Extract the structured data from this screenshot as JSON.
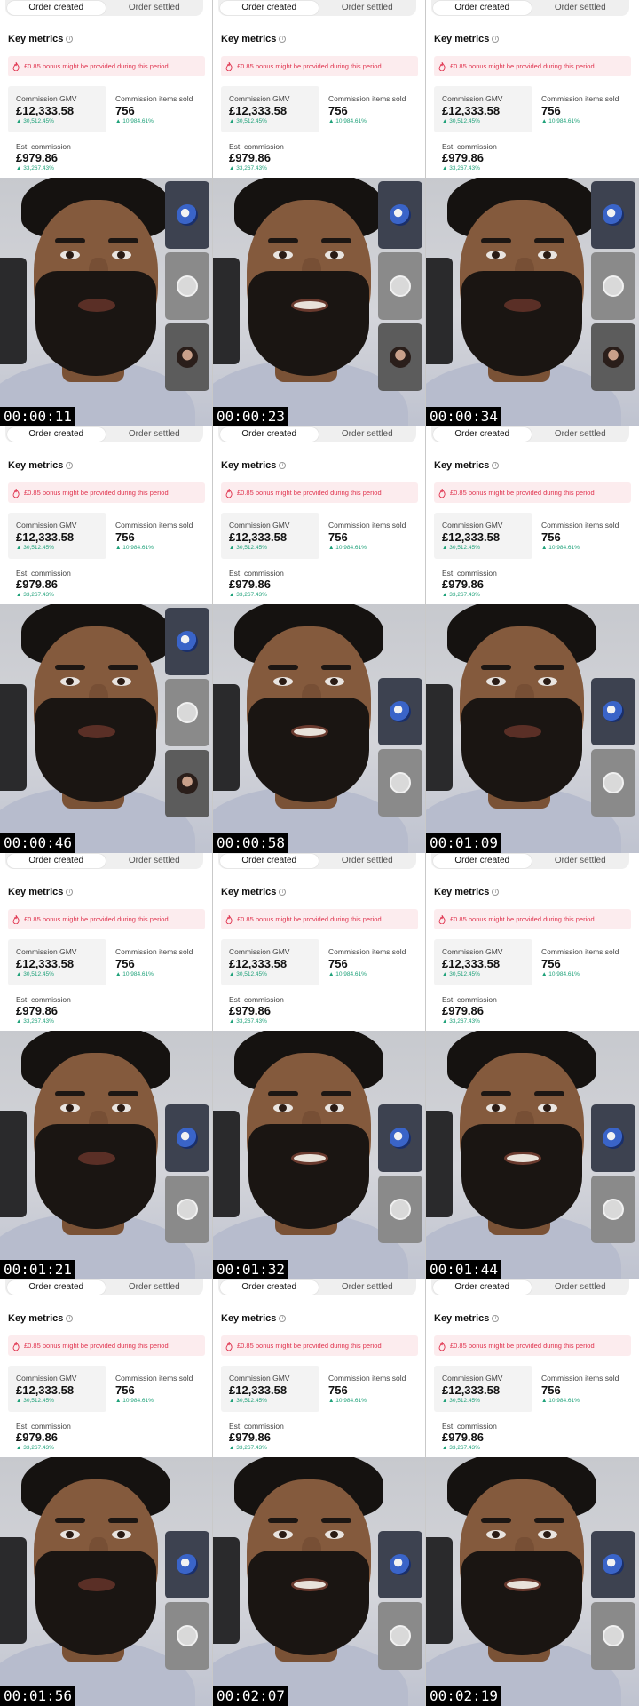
{
  "tabs": {
    "active": "Order created",
    "inactive": "Order settled"
  },
  "section_title": "Key metrics",
  "info_icon": "info-icon",
  "bonus_notice": "£0.85 bonus might be provided during this period",
  "metrics": {
    "gmv": {
      "label": "Commission GMV",
      "value": "£12,333.58",
      "change": "▲ 30,512.45%"
    },
    "items": {
      "label": "Commission items sold",
      "value": "756",
      "change": "▲ 10,984.61%"
    },
    "commission": {
      "label": "Est. commission",
      "value": "£979.86",
      "change": "▲ 33,267.43%"
    }
  },
  "colors": {
    "change_positive": "#1ea179",
    "notice_text": "#e0344f",
    "notice_bg": "#fcecee"
  },
  "frames": [
    {
      "timestamp": "00:00:11",
      "thumbnails": [
        "globe-avatar",
        "phone-avatar",
        "woman-avatar"
      ]
    },
    {
      "timestamp": "00:00:23",
      "thumbnails": [
        "globe-avatar",
        "phone-avatar",
        "woman-avatar"
      ]
    },
    {
      "timestamp": "00:00:34",
      "thumbnails": [
        "globe-avatar",
        "phone-avatar",
        "woman-avatar"
      ]
    },
    {
      "timestamp": "00:00:46",
      "thumbnails": [
        "globe-avatar",
        "phone-avatar",
        "woman-avatar"
      ]
    },
    {
      "timestamp": "00:00:58",
      "thumbnails": [
        "globe-avatar",
        "phone-avatar"
      ]
    },
    {
      "timestamp": "00:01:09",
      "thumbnails": [
        "globe-avatar",
        "phone-avatar"
      ]
    },
    {
      "timestamp": "00:01:21",
      "thumbnails": [
        "globe-avatar",
        "phone-avatar"
      ]
    },
    {
      "timestamp": "00:01:32",
      "thumbnails": [
        "globe-avatar",
        "phone-avatar"
      ]
    },
    {
      "timestamp": "00:01:44",
      "thumbnails": [
        "globe-avatar",
        "phone-avatar"
      ]
    },
    {
      "timestamp": "00:01:56",
      "thumbnails": [
        "globe-avatar",
        "phone-avatar"
      ]
    },
    {
      "timestamp": "00:02:07",
      "thumbnails": [
        "globe-avatar",
        "phone-avatar"
      ]
    },
    {
      "timestamp": "00:02:19",
      "thumbnails": [
        "globe-avatar",
        "phone-avatar"
      ]
    }
  ]
}
